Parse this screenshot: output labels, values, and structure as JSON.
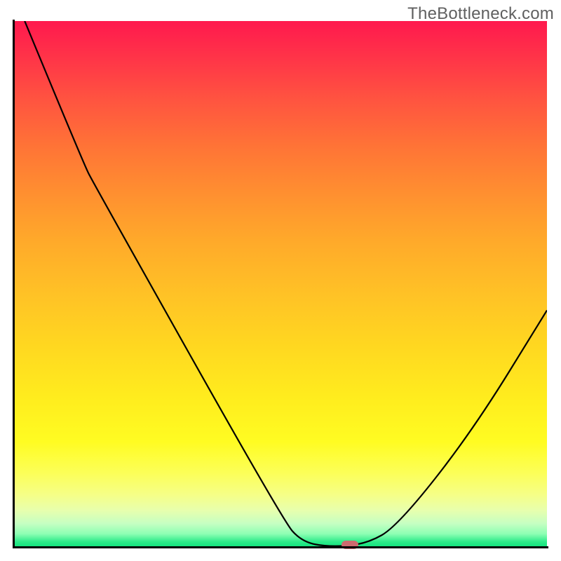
{
  "watermark": "TheBottleneck.com",
  "chart_data": {
    "type": "line",
    "title": "",
    "xlabel": "",
    "ylabel": "",
    "x_range": [
      0,
      100
    ],
    "y_range": [
      0,
      100
    ],
    "series": [
      {
        "name": "bottleneck-curve",
        "points": [
          {
            "x": 2,
            "y": 100
          },
          {
            "x": 13,
            "y": 73
          },
          {
            "x": 15,
            "y": 69
          },
          {
            "x": 50.5,
            "y": 5
          },
          {
            "x": 54,
            "y": 1
          },
          {
            "x": 59,
            "y": 0
          },
          {
            "x": 66,
            "y": 0.5
          },
          {
            "x": 72,
            "y": 4
          },
          {
            "x": 86,
            "y": 22
          },
          {
            "x": 100,
            "y": 45
          }
        ]
      }
    ],
    "marker": {
      "x": 63,
      "y": 0.4
    },
    "background_gradient": {
      "stops": [
        {
          "pos": 0,
          "color": "#ff194e"
        },
        {
          "pos": 50,
          "color": "#ffc226"
        },
        {
          "pos": 80,
          "color": "#fffc22"
        },
        {
          "pos": 100,
          "color": "#11e47d"
        }
      ]
    }
  }
}
